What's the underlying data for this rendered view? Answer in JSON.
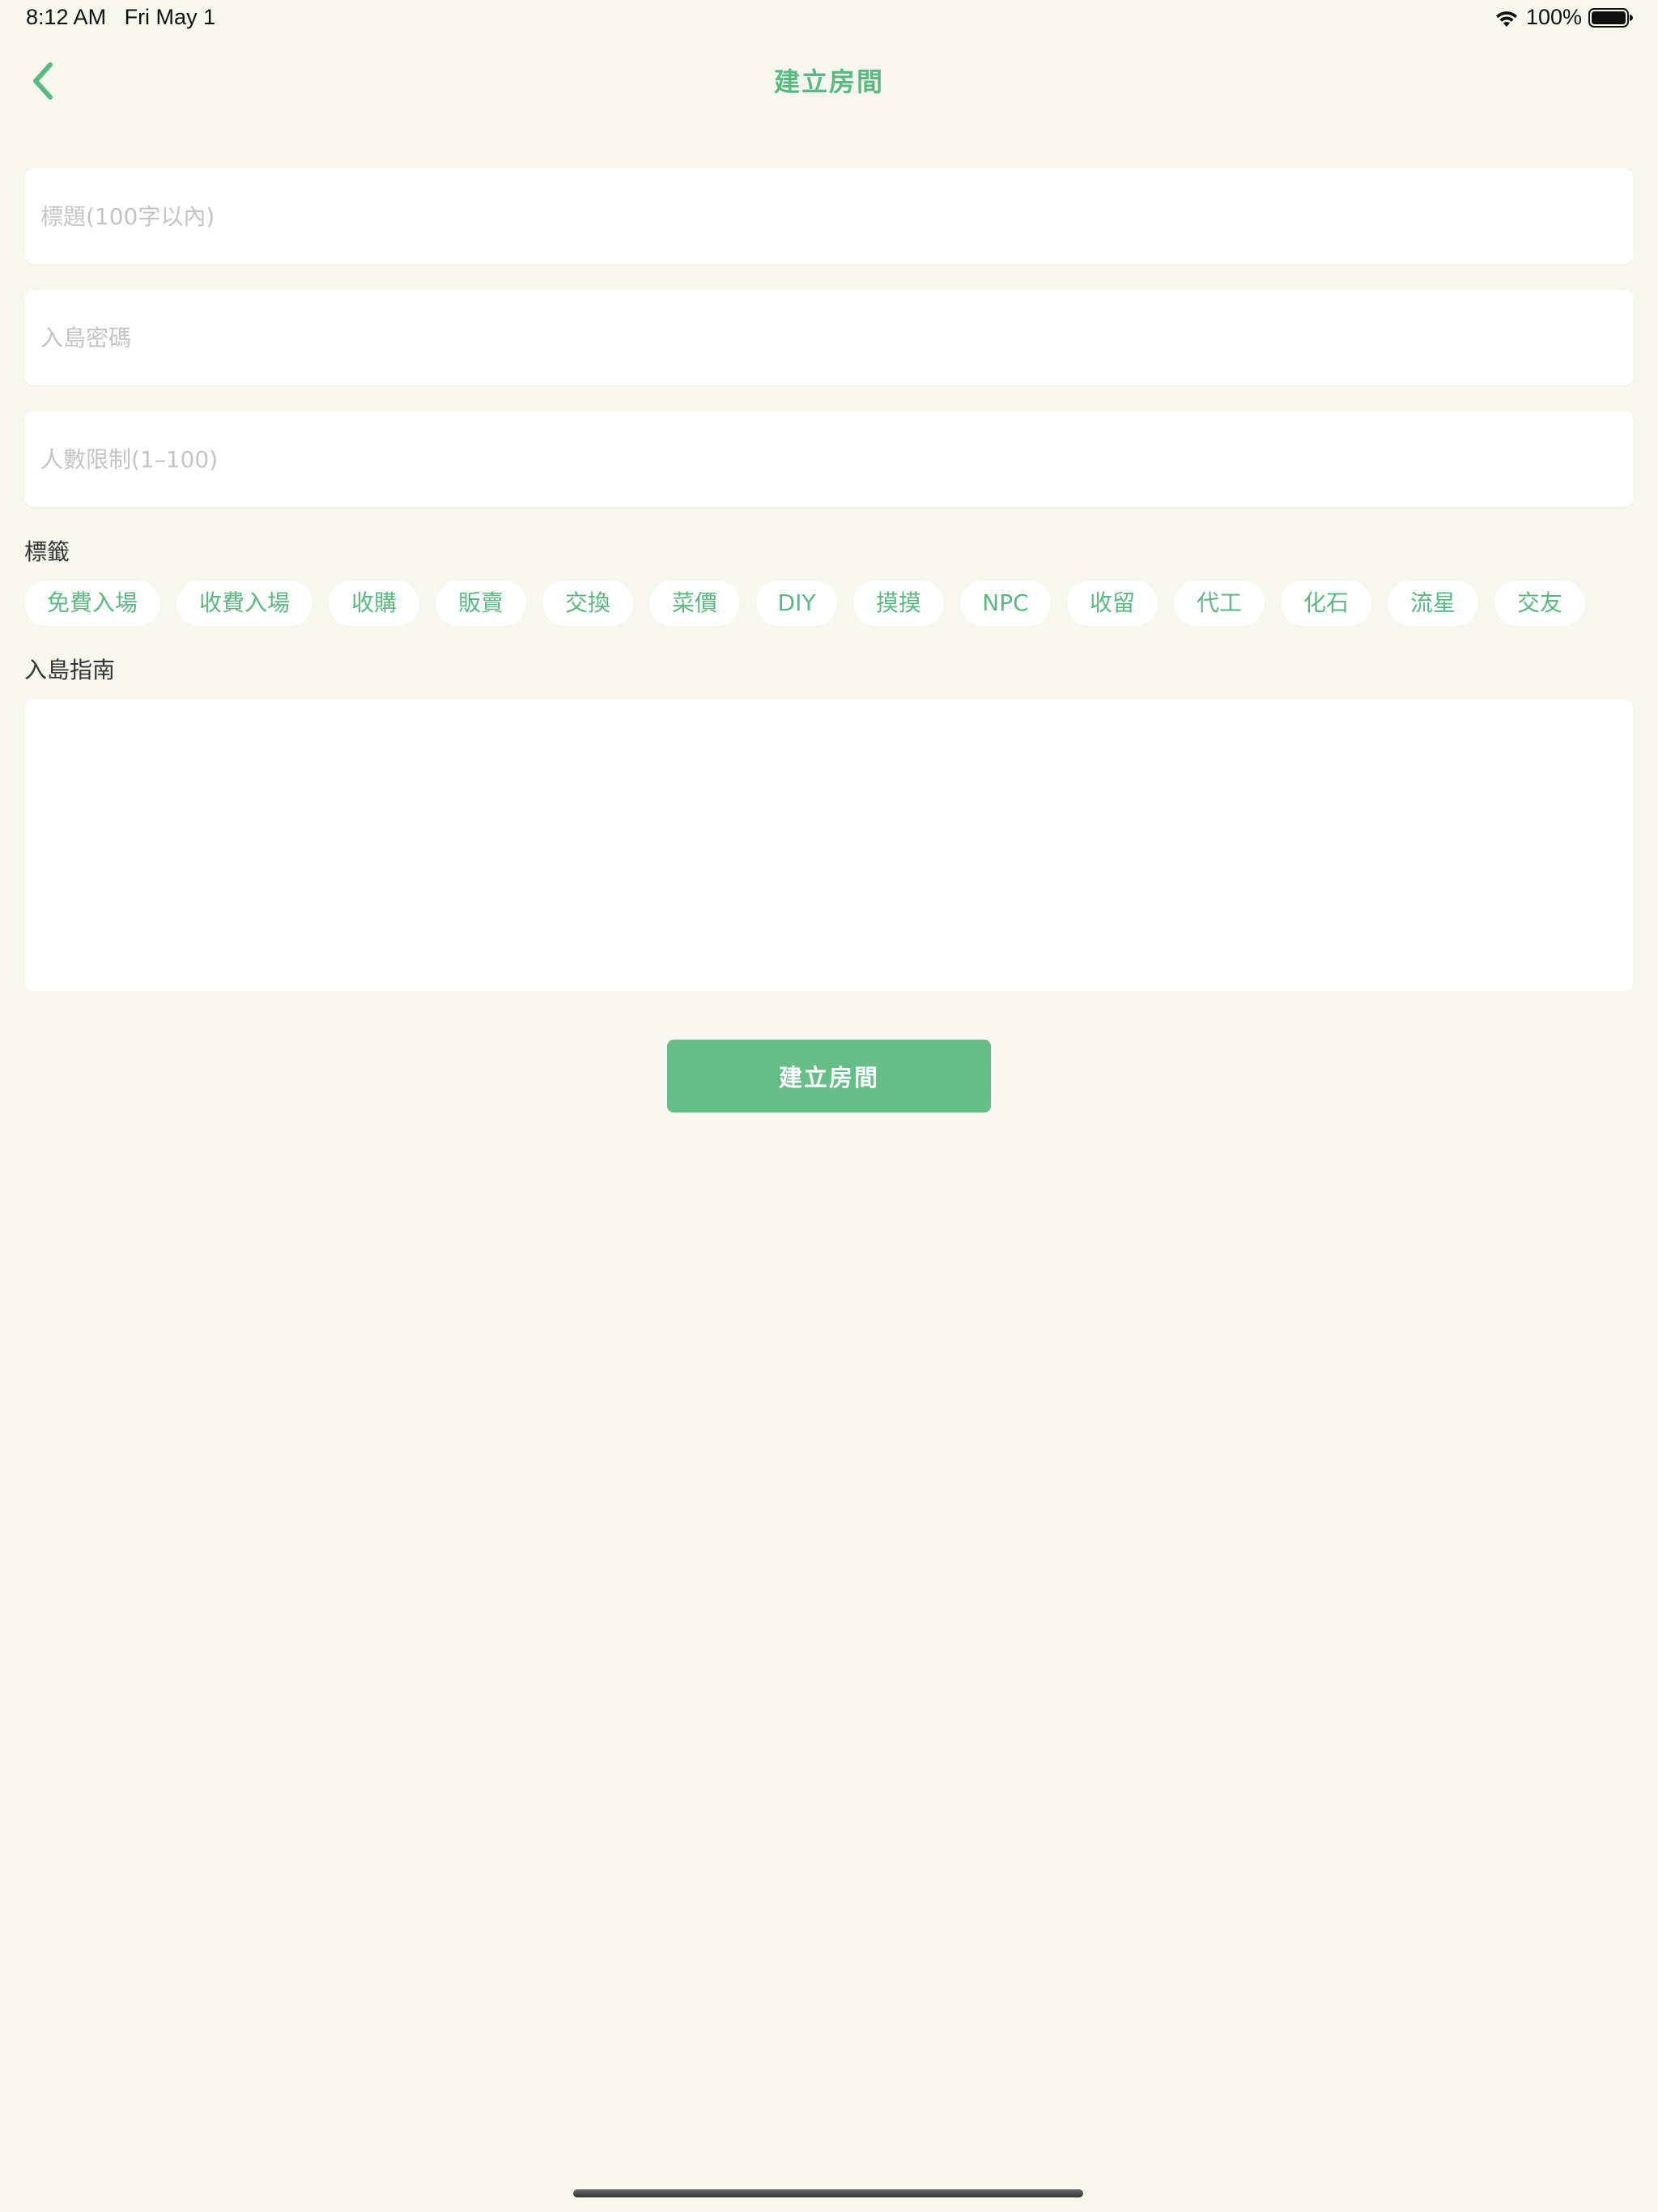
{
  "status_bar": {
    "time": "8:12 AM",
    "date": "Fri May 1",
    "battery": "100%"
  },
  "nav": {
    "title": "建立房間",
    "back_icon": "chevron-left-icon"
  },
  "form": {
    "title_field": {
      "value": "",
      "placeholder": "標題(100字以內)"
    },
    "password_field": {
      "value": "",
      "placeholder": "入島密碼"
    },
    "limit_field": {
      "value": "",
      "placeholder": "人數限制(1–100)"
    },
    "tags_label": "標籤",
    "tags": [
      "免費入場",
      "收費入場",
      "收購",
      "販賣",
      "交換",
      "菜價",
      "DIY",
      "摸摸",
      "NPC",
      "收留",
      "代工",
      "化石",
      "流星",
      "交友"
    ],
    "guide_label": "入島指南",
    "guide_value": ""
  },
  "submit_label": "建立房間",
  "colors": {
    "accent": "#5cb883",
    "button": "#67bd88",
    "background": "#f7f6ef",
    "placeholder": "#c4c4c4"
  }
}
